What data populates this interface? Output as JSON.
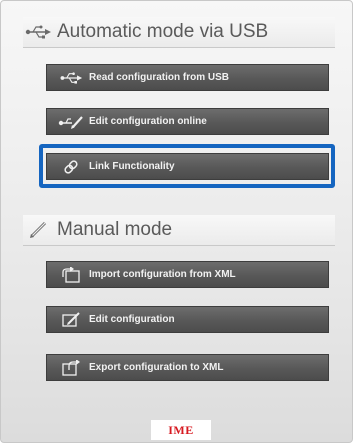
{
  "sections": {
    "usb": {
      "title": "Automatic mode via USB",
      "icon": "usb-icon"
    },
    "manual": {
      "title": "Manual mode",
      "icon": "pencil-icon"
    }
  },
  "buttons": {
    "read_usb": {
      "label": "Read configuration from USB",
      "icon": "usb-icon"
    },
    "edit_online": {
      "label": "Edit configuration online",
      "icon": "usb-pencil-icon"
    },
    "link": {
      "label": "Link Functionality",
      "icon": "link-icon"
    },
    "import_xml": {
      "label": "Import configuration from XML",
      "icon": "import-icon"
    },
    "edit": {
      "label": "Edit configuration",
      "icon": "edit-icon"
    },
    "export_xml": {
      "label": "Export configuration to XML",
      "icon": "export-icon"
    }
  },
  "highlight": {
    "target": "Link Functionality",
    "color": "#1565c0"
  },
  "logo": {
    "text": "IME",
    "color": "#d71920"
  }
}
